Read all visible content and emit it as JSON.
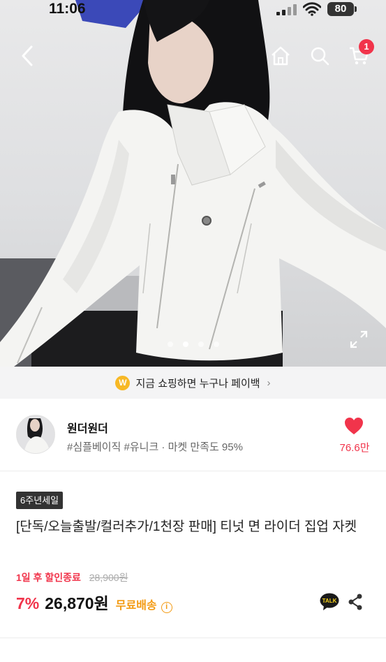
{
  "status_bar": {
    "time": "11:06",
    "battery": "80"
  },
  "nav": {
    "cart_count": "1"
  },
  "carousel": {
    "total": 4,
    "active_index": 1
  },
  "banner": {
    "text": "지금 쇼핑하면 누구나 페이백",
    "coin_label": "W"
  },
  "seller": {
    "name": "원더원더",
    "tags": "#심플베이직 #유니크 · 마켓 만족도 95%",
    "likes": "76.6만"
  },
  "product": {
    "badge": "6주년세일",
    "title": "[단독/오늘출발/컬러추가/1천장 판매] 티넛 면 라이더 집업 자켓",
    "sale_ends": "1일 후 할인종료",
    "original_price": "28,900원",
    "discount": "7%",
    "price": "26,870원",
    "shipping": "무료배송",
    "talk_label": "TALK"
  },
  "colors": {
    "accent": "#f1344b",
    "shipping": "#f39a12",
    "badge_bg": "#333333"
  }
}
